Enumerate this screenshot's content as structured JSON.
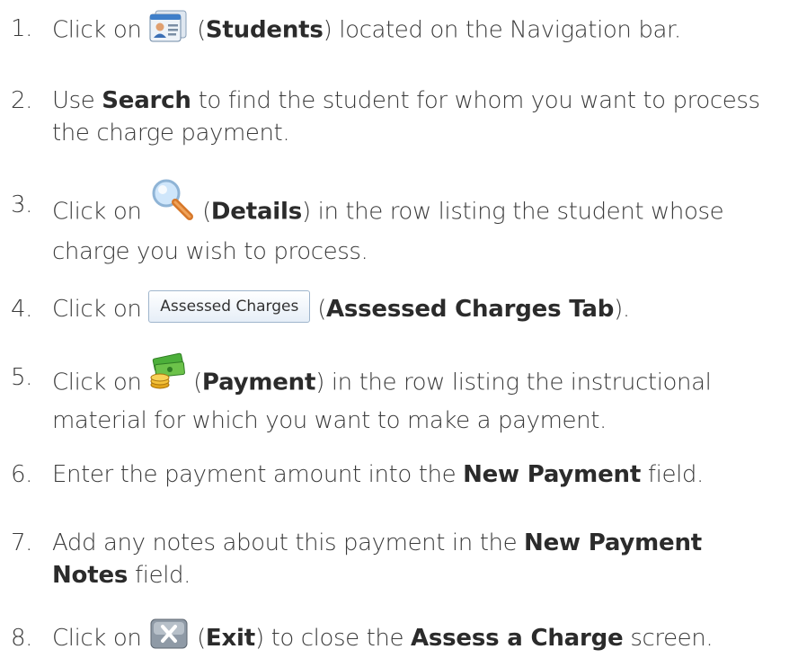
{
  "steps": [
    {
      "num": "1.",
      "pre": "Click on",
      "paren_open": "(",
      "bold": "Students",
      "paren_close": ")",
      "post": " located on the Navigation bar.",
      "icon": "students-icon"
    },
    {
      "num": "2.",
      "pre": "Use ",
      "bold": "Search",
      "post": " to find the student for whom you want to process the charge payment."
    },
    {
      "num": "3.",
      "pre": "Click on",
      "paren_open": "(",
      "bold": "Details",
      "paren_close": ")",
      "post": " in the row listing the student whose charge you wish to process.",
      "icon": "magnifier-icon"
    },
    {
      "num": "4.",
      "pre": "Click on",
      "button_label": "Assessed Charges",
      "paren_open": "(",
      "bold": "Assessed Charges Tab",
      "paren_close": ").",
      "icon": "assessed-charges-tab"
    },
    {
      "num": "5.",
      "pre": "Click on",
      "paren_open": "(",
      "bold": "Payment",
      "paren_close": ")",
      "post": " in the row listing the instructional material for which you want to make a payment.",
      "icon": "money-icon"
    },
    {
      "num": "6.",
      "pre": "Enter the payment amount into the ",
      "bold": "New Payment",
      "post": " field."
    },
    {
      "num": "7.",
      "pre": "Add any notes about this payment in the ",
      "bold": "New Payment Notes",
      "post": " field."
    },
    {
      "num": "8.",
      "pre": "Click on",
      "paren_open": "(",
      "bold": "Exit",
      "paren_close": ")",
      "post": " to close the ",
      "bold2": "Assess a Charge",
      "post2": " screen.",
      "icon": "exit-icon"
    }
  ]
}
